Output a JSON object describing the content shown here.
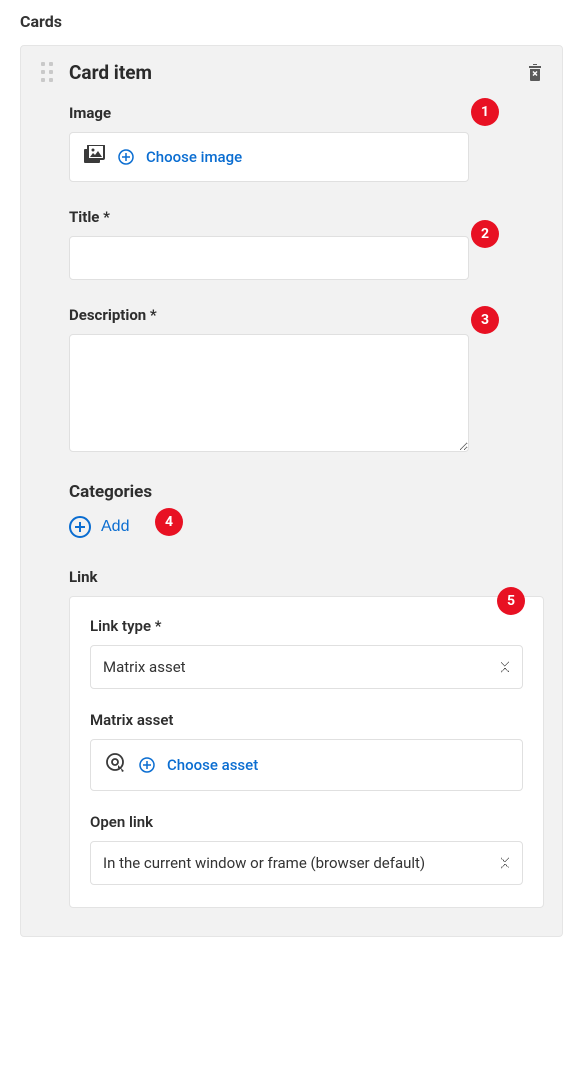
{
  "section_title": "Cards",
  "card": {
    "title": "Card item",
    "image": {
      "label": "Image",
      "choose_label": "Choose image"
    },
    "title_field": {
      "label": "Title *",
      "value": ""
    },
    "description_field": {
      "label": "Description *",
      "value": ""
    },
    "categories": {
      "label": "Categories",
      "add_label": "Add"
    },
    "link": {
      "label": "Link",
      "link_type": {
        "label": "Link type *",
        "value": "Matrix asset"
      },
      "matrix_asset": {
        "label": "Matrix asset",
        "choose_label": "Choose asset"
      },
      "open_link": {
        "label": "Open link",
        "value": "In the current window or frame (browser default)"
      }
    }
  },
  "badges": {
    "b1": "1",
    "b2": "2",
    "b3": "3",
    "b4": "4",
    "b5": "5"
  }
}
